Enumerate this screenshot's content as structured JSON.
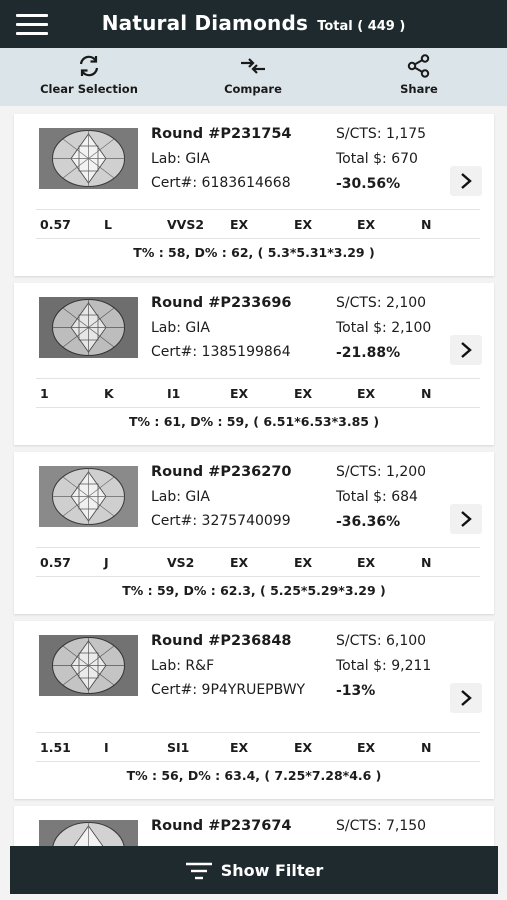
{
  "header": {
    "title": "Natural Diamonds",
    "subtitle": "Total ( 449 )",
    "menu_icon": "hamburger-menu-icon"
  },
  "toolbar": {
    "clear_label": "Clear Selection",
    "compare_label": "Compare",
    "share_label": "Share"
  },
  "diamonds": [
    {
      "title": "Round #P231754",
      "lab": "Lab: GIA",
      "cert": "Cert#: 6183614668",
      "price_per_ct": "S/CTS: 1,175",
      "total": "Total $: 670",
      "discount": "-30.56%",
      "specs": [
        "0.57",
        "L",
        "VVS2",
        "EX",
        "EX",
        "EX",
        "N"
      ],
      "measurements": "T% : 58, D% : 62, ( 5.3*5.31*3.29 )"
    },
    {
      "title": "Round #P233696",
      "lab": "Lab: GIA",
      "cert": "Cert#: 1385199864",
      "price_per_ct": "S/CTS: 2,100",
      "total": "Total $: 2,100",
      "discount": "-21.88%",
      "specs": [
        "1",
        "K",
        "I1",
        "EX",
        "EX",
        "EX",
        "N"
      ],
      "measurements": "T% : 61, D% : 59, ( 6.51*6.53*3.85 )"
    },
    {
      "title": "Round #P236270",
      "lab": "Lab: GIA",
      "cert": "Cert#: 3275740099",
      "price_per_ct": "S/CTS: 1,200",
      "total": "Total $: 684",
      "discount": "-36.36%",
      "specs": [
        "0.57",
        "J",
        "VS2",
        "EX",
        "EX",
        "EX",
        "N"
      ],
      "measurements": "T% : 59, D% : 62.3, ( 5.25*5.29*3.29 )"
    },
    {
      "title": "Round #P236848",
      "lab": "Lab: R&F",
      "cert": "Cert#: 9P4YRUEPBWY",
      "price_per_ct": "S/CTS: 6,100",
      "total": "Total $: 9,211",
      "discount": "-13%",
      "specs": [
        "1.51",
        "I",
        "SI1",
        "EX",
        "EX",
        "EX",
        "N"
      ],
      "measurements": "T% : 56, D% : 63.4, ( 7.25*7.28*4.6 )"
    },
    {
      "title": "Round #P237674",
      "price_per_ct": "S/CTS: 7,150"
    }
  ],
  "bottom_bar": {
    "label": "Show Filter"
  },
  "colors": {
    "header_bg": "#1e2a2e",
    "toolbar_bg": "#dbe4e8",
    "page_bg": "#f3f3f3"
  }
}
